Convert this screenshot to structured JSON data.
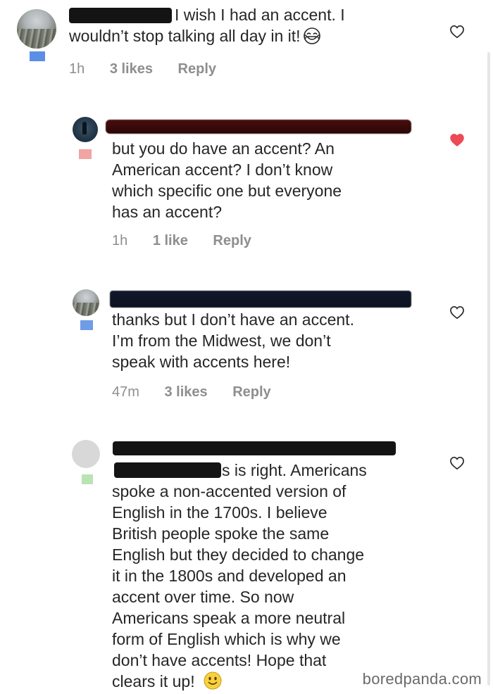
{
  "comments": [
    {
      "lines": [
        "I wish I had an accent. I",
        "wouldn’t stop talking all day in it!"
      ],
      "emoji": "laughing-with-tears-icon",
      "time": "1h",
      "likes": "3 likes",
      "reply": "Reply",
      "liked": false,
      "badge_color": "#5b8fe6"
    },
    {
      "lines": [
        "but you do have an accent? An",
        "American accent? I don’t know",
        "which specific one but everyone",
        "has an accent?"
      ],
      "time": "1h",
      "likes": "1 like",
      "reply": "Reply",
      "liked": true,
      "badge_color": "#f2a3a3"
    },
    {
      "lines": [
        "thanks but I don’t have an accent.",
        "I’m from the Midwest, we don’t",
        "speak with accents here!"
      ],
      "time": "47m",
      "likes": "3 likes",
      "reply": "Reply",
      "liked": false,
      "badge_color": "#6f9ce6"
    },
    {
      "lines": [
        "s is right. Americans",
        "spoke a non-accented version of",
        "English in the 1700s. I believe",
        "British people spoke the same",
        "English but they decided to change",
        "it in the 1800s and developed an",
        "accent over time. So now",
        "Americans speak a more neutral",
        "form of English which is why we",
        "don’t have accents! Hope that",
        "clears it up!"
      ],
      "emoji": "smiling-face-icon",
      "liked": false,
      "badge_color": "#b9e3b3"
    }
  ],
  "colors": {
    "heart_outline": "#262626",
    "heart_filled": "#ed4956",
    "meta_text": "#8e8e8e"
  },
  "watermark": "boredpanda.com"
}
